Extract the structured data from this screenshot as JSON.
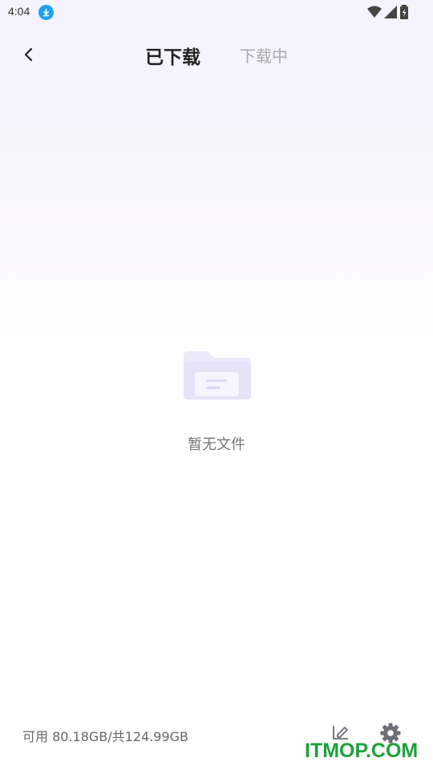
{
  "status_bar": {
    "time": "4:04",
    "icons": [
      "download-notification-icon",
      "wifi-icon",
      "signal-icon",
      "battery-icon"
    ]
  },
  "header": {
    "back_icon": "chevron-left-icon",
    "tabs": [
      {
        "label": "已下载",
        "active": true
      },
      {
        "label": "下载中",
        "active": false
      }
    ]
  },
  "empty_state": {
    "icon": "empty-folder-icon",
    "text": "暂无文件"
  },
  "footer": {
    "storage_text": "可用 80.18GB/共124.99GB",
    "edit_icon": "edit-icon",
    "settings_icon": "gear-icon"
  },
  "watermark": "ITMOP.COM",
  "colors": {
    "accent_light": "#ece9fb",
    "download_badge": "#1da1f2",
    "watermark": "#1aa33a"
  }
}
